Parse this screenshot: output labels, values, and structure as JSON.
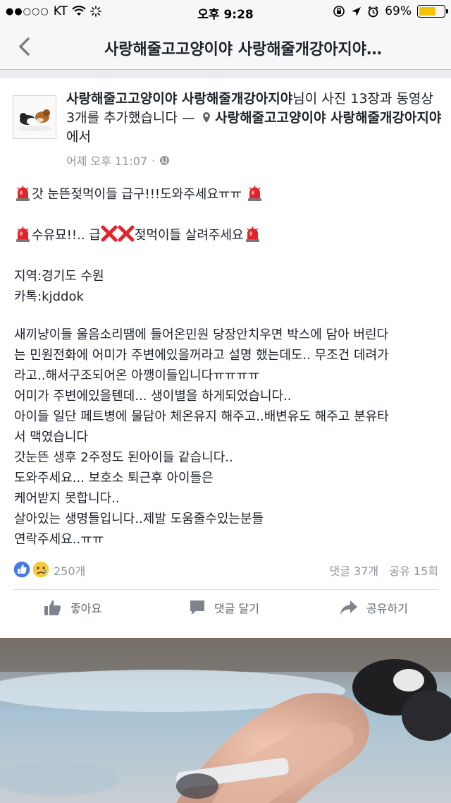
{
  "status_bar": {
    "carrier": "KT",
    "time": "오후 9:28",
    "battery": "69%",
    "battery_level": 0.69
  },
  "nav": {
    "title": "사랑해줄고고양이야 사랑해줄개강아지야…",
    "back_icon": "chevron-left-icon"
  },
  "post": {
    "header": {
      "author": "사랑해줄고고양이야 사랑해줄개강아지야",
      "action": "님이 사진 13장과 동영상 3개를 추가했습니다 — ",
      "location": "사랑해줄고고양이야 사랑해줄개강아지야",
      "location_suffix": "에서"
    },
    "timestamp": "어제 오후 11:07",
    "body": {
      "line1": "갓 눈뜬젖먹이들 급구!!!도와주세요ㅠㅠ",
      "line2a": "수유묘!!.. 급",
      "line2b": "젖먹이들 살려주세요",
      "region": "지역:경기도 수원",
      "kakao": "카톡:kjddok",
      "paragraph": [
        "새끼냥이들 울음소리땜에 들어온민원 당장안치우면  박스에 담아 버린다",
        "는 민원전화에  어미가 주변에있을꺼라고 설명 했는데도.. 무조건 데려가",
        "라고..해서구조되어온 아깽이들입니다ㅠㅠㅠㅠ",
        "어미가 주변에있을텐데... 생이별을 하게되었습니다..",
        "아이들 일단 페트병에 물담아 체온유지 해주고..배변유도 해주고  분유타",
        "서 맥였습니다",
        "갓눈뜬 생후 2주정도 된아이들 같습니다..",
        "도와주세요... 보호소 퇴근후 아이들은",
        "케어받지 못합니다..",
        "살아있는 생명들입니다..제발 도움줄수있는분들",
        "연락주세요..ㅠㅠ"
      ]
    },
    "reactions": {
      "count": "250개",
      "comments": "댓글 37개",
      "shares": "공유 15회"
    },
    "actions": {
      "like": "좋아요",
      "comment": "댓글 달기",
      "share": "공유하기"
    }
  },
  "colors": {
    "fb_blue": "#4267b2",
    "meta_gray": "#90949c",
    "text": "#1d2129"
  }
}
